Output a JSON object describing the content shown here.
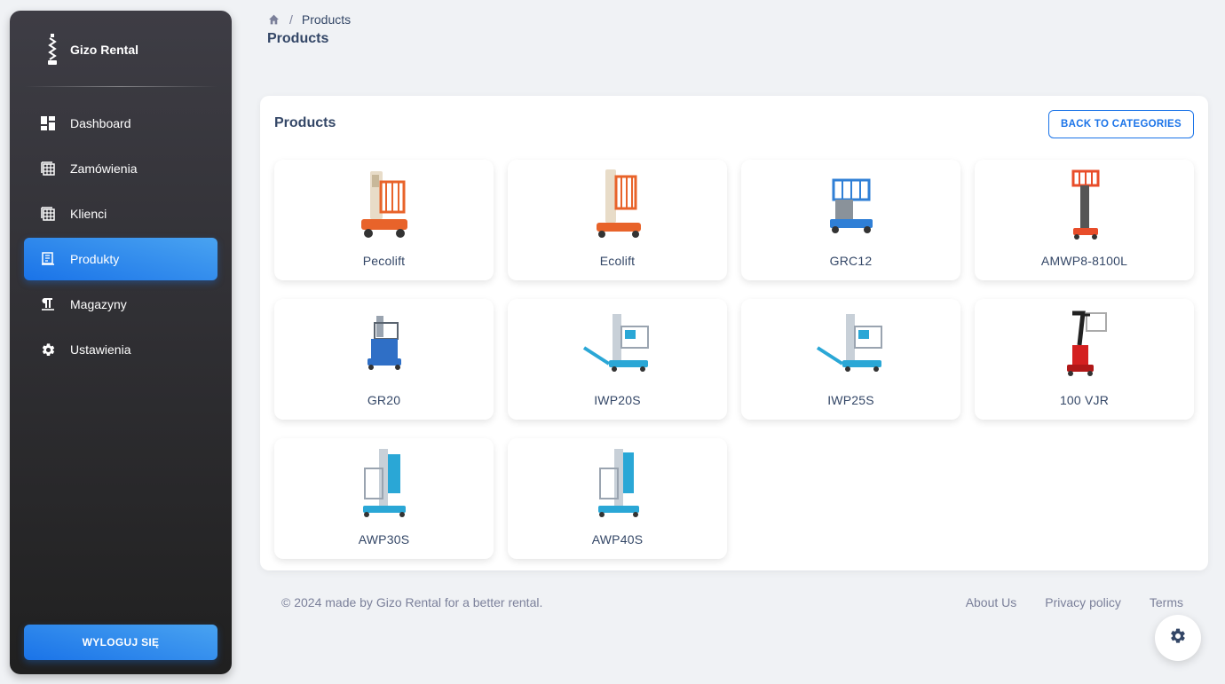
{
  "sidebar": {
    "brand": "Gizo Rental",
    "items": [
      {
        "label": "Dashboard",
        "icon": "dashboard-icon"
      },
      {
        "label": "Zamówienia",
        "icon": "table-icon"
      },
      {
        "label": "Klienci",
        "icon": "table-icon"
      },
      {
        "label": "Produkty",
        "icon": "receipt-icon",
        "active": true
      },
      {
        "label": "Magazyny",
        "icon": "format-paragraph-icon"
      },
      {
        "label": "Ustawienia",
        "icon": "gear-icon"
      }
    ],
    "logout_label": "WYLOGUJ SIĘ"
  },
  "header": {
    "breadcrumb_current": "Products",
    "breadcrumb_sep": "/",
    "title": "Products"
  },
  "card": {
    "title": "Products",
    "back_label": "BACK TO CATEGORIES",
    "products": [
      {
        "name": "Pecolift",
        "color": "#e8632a"
      },
      {
        "name": "Ecolift",
        "color": "#e8632a"
      },
      {
        "name": "GRC12",
        "color": "#2f7fd6"
      },
      {
        "name": "AMWP8-8100L",
        "color": "#e84d2a"
      },
      {
        "name": "GR20",
        "color": "#2f6fc6"
      },
      {
        "name": "IWP20S",
        "color": "#2aa7d6"
      },
      {
        "name": "IWP25S",
        "color": "#2aa7d6"
      },
      {
        "name": "100 VJR",
        "color": "#d42020"
      },
      {
        "name": "AWP30S",
        "color": "#2aa7d6"
      },
      {
        "name": "AWP40S",
        "color": "#2aa7d6"
      }
    ]
  },
  "footer": {
    "copyright": "© 2024 made by Gizo Rental for a better rental.",
    "links": [
      "About Us",
      "Privacy policy",
      "Terms"
    ]
  },
  "colors": {
    "accent": "#1a73e8",
    "text": "#344767",
    "muted": "#7b809a"
  }
}
